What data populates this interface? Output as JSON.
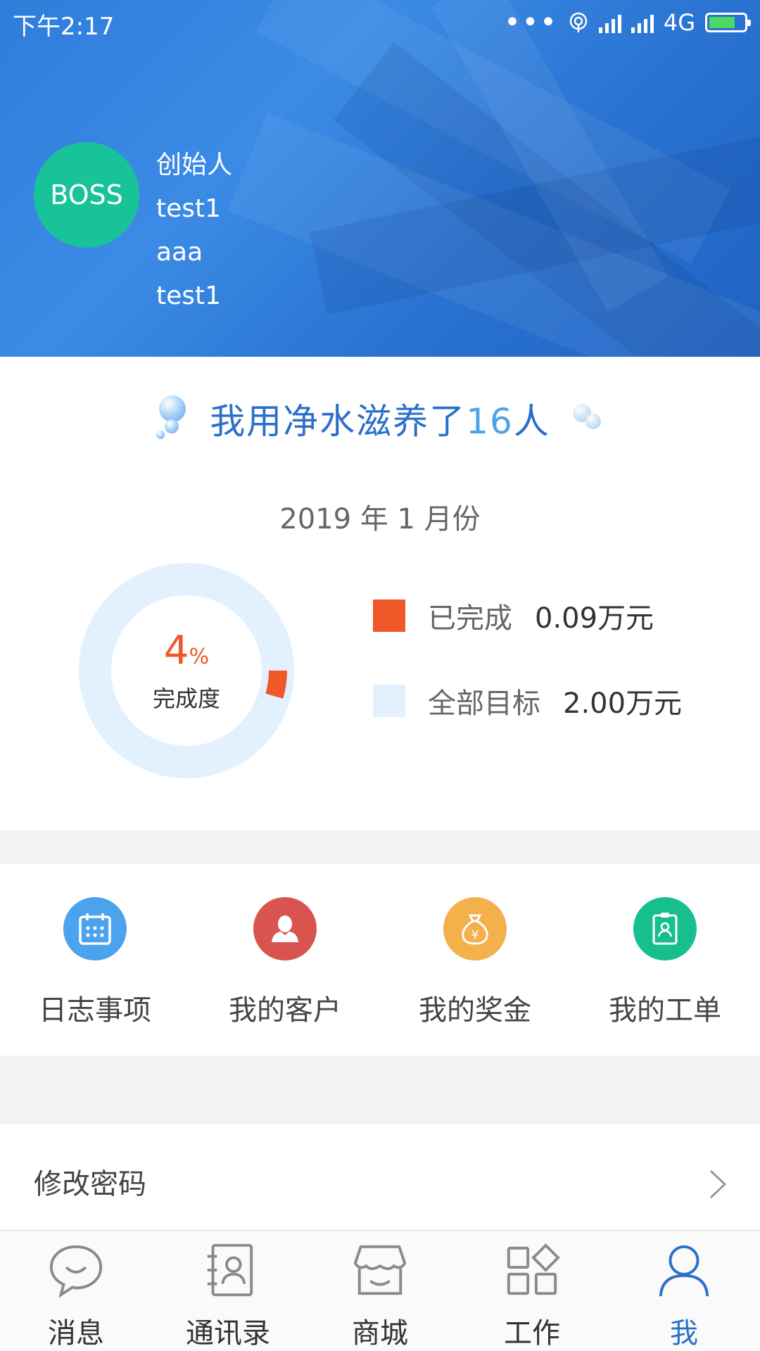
{
  "status_bar": {
    "time": "下午2:17",
    "network": "4G"
  },
  "profile": {
    "avatar_text": "BOSS",
    "lines": [
      "创始人",
      "test1",
      "aaa",
      "test1"
    ]
  },
  "slogan": {
    "text": "我用净水滋养了",
    "count": "16",
    "suffix": "人"
  },
  "month_label": "2019 年 1 月份",
  "progress": {
    "percent": "4",
    "percent_sign": "%",
    "center_label": "完成度",
    "completed_label": "已完成",
    "completed_value": "0.09万元",
    "target_label": "全部目标",
    "target_value": "2.00万元",
    "completed_color": "#f0582a",
    "target_color": "#e3f0fd"
  },
  "chart_data": {
    "type": "pie",
    "categories": [
      "已完成",
      "全部目标"
    ],
    "values": [
      0.09,
      2.0
    ],
    "unit": "万元",
    "center_text": "4%"
  },
  "tiles": [
    {
      "label": "日志事项",
      "icon": "calendar-icon",
      "color": "#4aa3ec"
    },
    {
      "label": "我的客户",
      "icon": "customer-icon",
      "color": "#d9534f"
    },
    {
      "label": "我的奖金",
      "icon": "money-bag-icon",
      "color": "#f4b04a"
    },
    {
      "label": "我的工单",
      "icon": "work-order-icon",
      "color": "#17bf8e"
    }
  ],
  "settings": {
    "change_password": "修改密码"
  },
  "tabbar": {
    "active_color": "#2a6fc9",
    "items": [
      {
        "label": "消息",
        "icon": "chat-icon"
      },
      {
        "label": "通讯录",
        "icon": "contacts-icon"
      },
      {
        "label": "商城",
        "icon": "store-icon"
      },
      {
        "label": "工作",
        "icon": "apps-icon"
      },
      {
        "label": "我",
        "icon": "person-icon"
      }
    ]
  }
}
